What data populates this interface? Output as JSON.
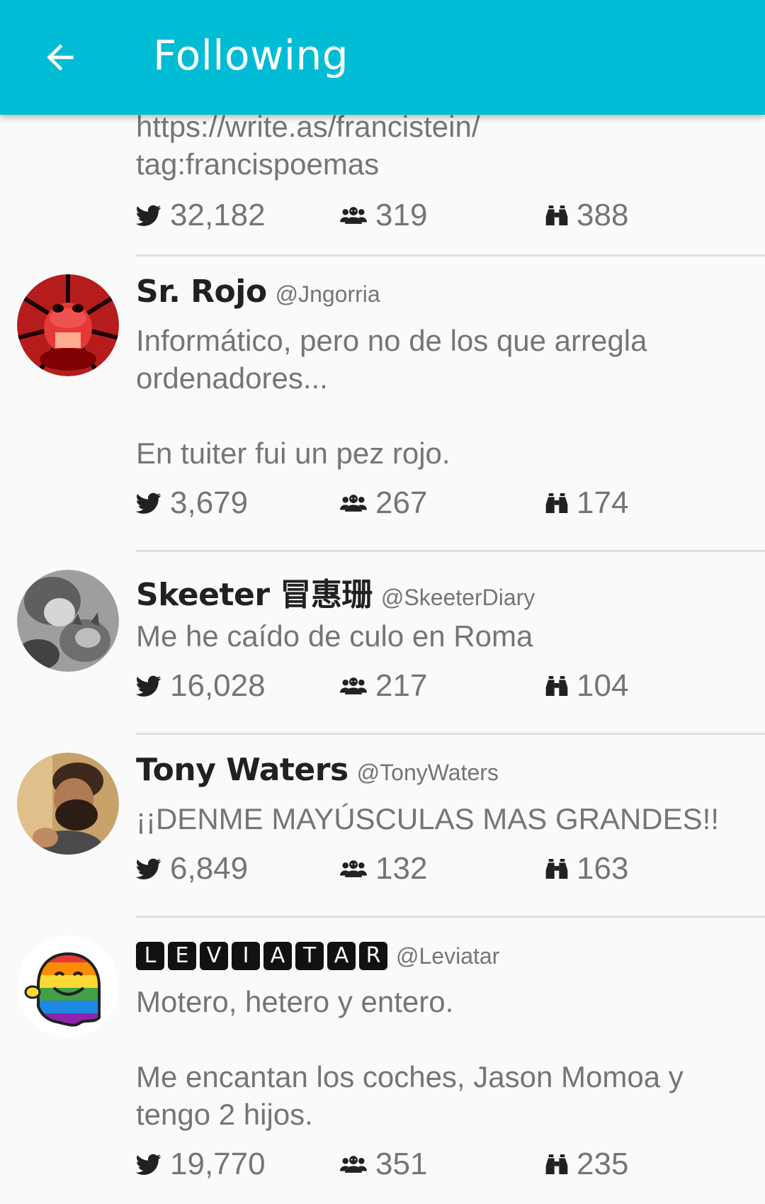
{
  "appbar": {
    "title": "Following",
    "back_icon": "arrow-left-icon",
    "color": "#00bcd4"
  },
  "partial_entry": {
    "bio_lines": [
      "https://write.as/francistein/",
      "tag:francispoemas"
    ],
    "tweets": "32,182",
    "followers": "319",
    "following": "388"
  },
  "users": [
    {
      "name": "Sr. Rojo",
      "handle": "@Jngorria",
      "bio": "Informático, pero no de los que arregla ordenadores...\n\nEn tuiter fui un pez rojo.",
      "tweets": "3,679",
      "followers": "267",
      "following": "174"
    },
    {
      "name": "Skeeter 冒惠珊",
      "handle": "@SkeeterDiary",
      "bio": "Me he caído de culo en Roma",
      "tweets": "16,028",
      "followers": "217",
      "following": "104"
    },
    {
      "name": "Tony Waters",
      "handle": "@TonyWaters",
      "bio": "¡¡DENME MAYÚSCULAS MAS GRANDES!!",
      "tweets": "6,849",
      "followers": "132",
      "following": "163"
    },
    {
      "name_letters": [
        "L",
        "E",
        "V",
        "I",
        "A",
        "T",
        "A",
        "R"
      ],
      "handle": "@Leviatar",
      "bio": "Motero, hetero y entero.\n\nMe encantan los coches, Jason Momoa y tengo 2 hijos.",
      "tweets": "19,770",
      "followers": "351",
      "following": "235"
    }
  ],
  "icons": {
    "tweets": "bird-icon",
    "followers": "group-icon",
    "following": "binoculars-icon"
  }
}
